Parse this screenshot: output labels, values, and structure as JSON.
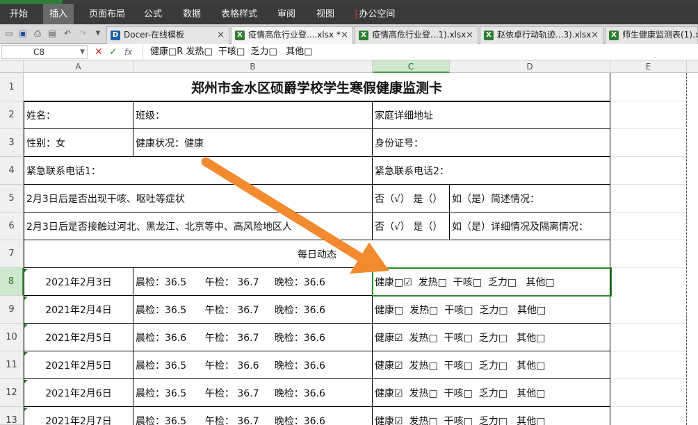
{
  "menu": {
    "items": [
      "开始",
      "插入",
      "页面布局",
      "公式",
      "数据",
      "表格样式",
      "审阅",
      "视图"
    ],
    "active_index": 1,
    "office_space": "办公空间"
  },
  "tabs": [
    {
      "label": "Docer-在线模板",
      "icon": "docer-icon"
    },
    {
      "label": "疫情高危行业登....xlsx *",
      "icon": "excel-file-icon"
    },
    {
      "label": "疫情高危行业登...1).xlsx",
      "icon": "excel-file-icon"
    },
    {
      "label": "赵依卓行动轨迹...3).xlsx",
      "icon": "excel-file-icon"
    },
    {
      "label": "师生健康监测表(1).x",
      "icon": "excel-file-icon"
    }
  ],
  "formula_bar": {
    "cell_ref": "C8",
    "fx": "fx",
    "content": "健康□R 发热□  干咳□  乏力□   其他□"
  },
  "columns": [
    "A",
    "B",
    "C",
    "D",
    "E"
  ],
  "rows": [
    "1",
    "2",
    "3",
    "4",
    "5",
    "6",
    "7",
    "8",
    "9",
    "10",
    "11",
    "12",
    "13"
  ],
  "sheet": {
    "title": "郑州市金水区硕爵学校学生寒假健康监测卡",
    "r2": {
      "name": "姓名：",
      "class": "班级：",
      "address": "家庭详细地址"
    },
    "r3": {
      "gender": "性别：女",
      "health": "健康状况：健康",
      "id": "身份证号："
    },
    "r4": {
      "phone1": "紧急联系电话1：",
      "phone2": "紧急联系电话2："
    },
    "r5": {
      "question": "2月3日后是否出现干咳、呕吐等症状",
      "answer": "否（√） 是（）",
      "detail": "如（是）简述情况："
    },
    "r6": {
      "question": "2月3日后是否接触过河北、黑龙江、北京等中、高风险地区人",
      "answer": "否（√） 是（）",
      "detail": "如（是）详细情况及隔离情况："
    },
    "r7": {
      "daily": "每日动态"
    },
    "daily": [
      {
        "date": "2021年2月3日",
        "temps": "晨检：36.5      午检： 36.7     晚检：36.6",
        "status": "健康□☑  发热□  干咳□  乏力□   其他□"
      },
      {
        "date": "2021年2月4日",
        "temps": "晨检：36.5      午检： 36.7     晚检：36.6",
        "status": "健康□  发热□  干咳□  乏力□   其他□"
      },
      {
        "date": "2021年2月5日",
        "temps": "晨检：36.6      午检： 36.7     晚检：36.6",
        "status": "健康☑  发热□  干咳□  乏力□   其他□"
      },
      {
        "date": "2021年2月5日",
        "temps": "晨检：36.5      午检： 36.6     晚检：36.6",
        "status": "健康☑  发热□  干咳□  乏力□   其他□"
      },
      {
        "date": "2021年2月6日",
        "temps": "晨检：36.5      午检： 36.7     晚检：36.6",
        "status": "健康☑  发热□  干咳□  乏力□   其他□"
      },
      {
        "date": "2021年2月7日",
        "temps": "晨检：36.5      午检： 36.7     晚检：36.6",
        "status": "健康☑  发热□  干咳□  乏力□   其他□"
      }
    ]
  },
  "colors": {
    "accent": "#2a8a2a",
    "arrow": "#f28a30",
    "menubar": "#3a3a3a"
  }
}
